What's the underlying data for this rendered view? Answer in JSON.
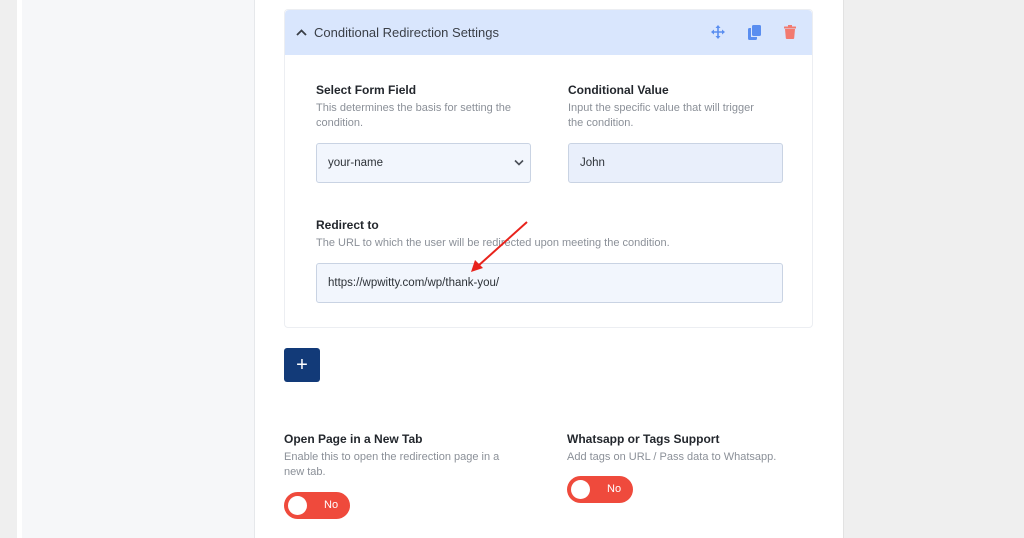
{
  "card": {
    "title": "Conditional Redirection Settings",
    "icons": [
      "chevron-up-icon",
      "move-icon",
      "copy-icon",
      "trash-icon"
    ]
  },
  "form_field": {
    "label": "Select Form Field",
    "description_line1": "This determines the basis for setting the",
    "description_line2": "condition.",
    "selected": "your-name"
  },
  "conditional_value": {
    "label": "Conditional Value",
    "description_line1": "Input the specific value that will trigger",
    "description_line2": "the condition.",
    "value": "John"
  },
  "redirect": {
    "label": "Redirect to",
    "description": "The URL to which the user will be redirected upon meeting the condition.",
    "value": "https://wpwitty.com/wp/thank-you/"
  },
  "add_button": {
    "label": "+"
  },
  "new_tab": {
    "label": "Open Page in a New Tab",
    "description_line1": "Enable this to open the redirection page in a",
    "description_line2": "new tab.",
    "toggle_label": "No",
    "enabled": false
  },
  "whatsapp": {
    "label": "Whatsapp or Tags Support",
    "description": "Add tags on URL / Pass data to Whatsapp.",
    "toggle_label": "No",
    "enabled": false
  },
  "colors": {
    "header_bg": "#d9e6fd",
    "accent_blue": "#123a78",
    "toggle_off": "#ef4a3c",
    "annotation_arrow": "#e8231c"
  }
}
